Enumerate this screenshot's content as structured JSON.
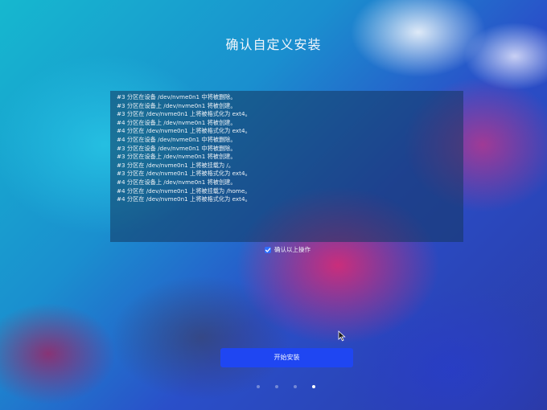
{
  "title": "确认自定义安装",
  "log_lines": [
    "#3 分区在设备 /dev/nvme0n1 中将被删除。",
    "#3 分区在设备上 /dev/nvme0n1 将被创建。",
    "#3 分区在 /dev/nvme0n1 上将被格式化为 ext4。",
    "#4 分区在设备上 /dev/nvme0n1 将被创建。",
    "#4 分区在 /dev/nvme0n1 上将被格式化为 ext4。",
    "#4 分区在设备 /dev/nvme0n1 中将被删除。",
    "#3 分区在设备 /dev/nvme0n1 中将被删除。",
    "#3 分区在设备上 /dev/nvme0n1 将被创建。",
    "#3 分区在 /dev/nvme0n1 上将被挂载为 /。",
    "#3 分区在 /dev/nvme0n1 上将被格式化为 ext4。",
    "#4 分区在设备上 /dev/nvme0n1 将被创建。",
    "#4 分区在 /dev/nvme0n1 上将被挂载为 /home。",
    "#4 分区在 /dev/nvme0n1 上将被格式化为 ext4。"
  ],
  "confirm": {
    "label": "确认以上操作",
    "checked": true
  },
  "install_button": {
    "label": "开始安装",
    "color": "#1f46f2"
  },
  "pagination": {
    "total": 4,
    "current": 4
  }
}
